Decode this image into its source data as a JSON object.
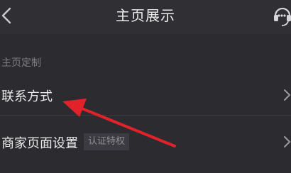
{
  "header": {
    "title": "主页展示",
    "back_icon": "chevron-left-icon",
    "service_icon": "headset-icon"
  },
  "section": {
    "label": "主页定制"
  },
  "rows": [
    {
      "label": "联系方式",
      "icon": "chevron-right-icon"
    },
    {
      "label": "商家页面设置",
      "badge": "认证特权",
      "icon": "chevron-right-icon"
    }
  ],
  "annotation": {
    "icon": "red-arrow-icon",
    "color": "#e0222b"
  },
  "colors": {
    "background": "#2b2b30",
    "text": "#ececec",
    "muted": "#7c7c82",
    "badge_bg": "#3b3b41"
  }
}
